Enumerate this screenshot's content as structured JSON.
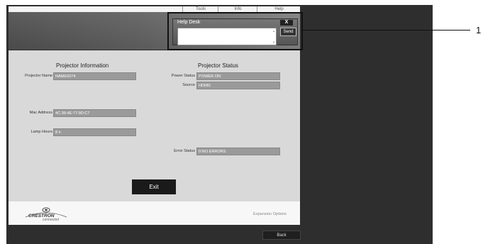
{
  "tabs": [
    "Tools",
    "Info",
    "Help"
  ],
  "help_desk": {
    "title": "Help Desk",
    "close_label": "X",
    "send_label": "Send",
    "message": ""
  },
  "callout_number": "1",
  "projector_info": {
    "heading": "Projector Information",
    "fields": [
      {
        "label": "Projector Name",
        "value": "NAME0074"
      },
      {
        "label": "Mac Address",
        "value": "4C:36:4E:77:9D:C7"
      },
      {
        "label": "Lamp Hours",
        "value": "8 h"
      }
    ]
  },
  "projector_status": {
    "heading": "Projector Status",
    "fields": [
      {
        "label": "Power Status",
        "value": "POWER ON"
      },
      {
        "label": "Source",
        "value": "HDMI1"
      },
      {
        "label": "Error Status",
        "value": "0:NO ERRORS"
      }
    ]
  },
  "exit_label": "Exit",
  "logo": {
    "brand": "CRESTRON",
    "tagline": "connected"
  },
  "expansion_label": "Expansion Options",
  "back_label": "Back",
  "colors": {
    "frame": "#2e2e2e",
    "panel": "#d9d9d9",
    "value_box": "#9a9a9a",
    "button": "#1a1a1a"
  }
}
